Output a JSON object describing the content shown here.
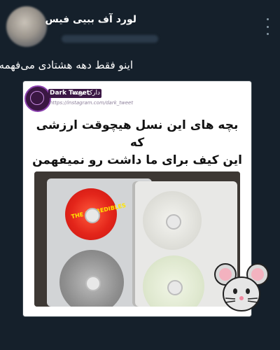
{
  "tweet": {
    "display_name": "لورد آف ببیی فیس",
    "text": "اینو فقط دهه هشتادی می‌فهمه :)"
  },
  "quoted": {
    "account_en": "Dark Tweet",
    "account_fa": "دارک تویت",
    "url": "https://instagram.com/dark_tweet",
    "caption_line1": "بچه های این نسل هیچوقت ارزشی که",
    "caption_line2": "این کیف برای ما داشت رو نمیفهمن",
    "disc_title": "THE INCREDIBLES"
  },
  "icons": {
    "more": "more-vertical-icon",
    "sticker": "mouse-sticker-icon"
  },
  "colors": {
    "background": "#15202b",
    "text": "#ffffff",
    "muted": "#8899a6",
    "brand": "#3b1745"
  }
}
